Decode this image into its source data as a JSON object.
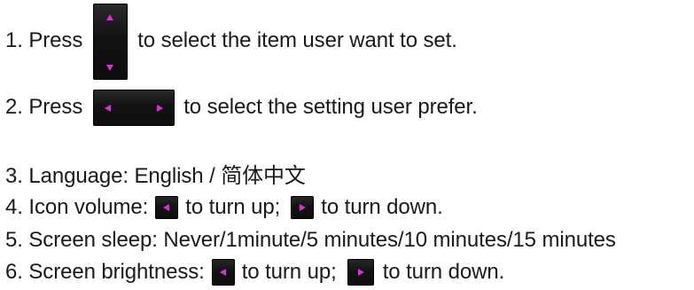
{
  "instructions": {
    "line1": {
      "prefix": "1. Press",
      "suffix": "to select the item user want to set.",
      "button_icon": "up-down-arrow-button"
    },
    "line2": {
      "prefix": "2. Press",
      "suffix": "to select the setting user prefer.",
      "button_icon": "left-right-arrow-button"
    },
    "line3": {
      "text": "3. Language: English / 简体中文"
    },
    "line4": {
      "prefix": "4. Icon volume:",
      "middle": "to turn up;",
      "suffix": "to turn down.",
      "icons": [
        "left-arrow-button",
        "right-arrow-button"
      ]
    },
    "line5": {
      "text": "5. Screen sleep: Never/1minute/5 minutes/10 minutes/15 minutes"
    },
    "line6": {
      "prefix": "6. Screen brightness:",
      "middle": "to turn up;",
      "suffix": "to turn down.",
      "icons": [
        "left-arrow-button",
        "right-arrow-button"
      ]
    }
  },
  "colors": {
    "arrow": "#e02bd6",
    "button_bg": "#141414",
    "text": "#1a1a1a"
  }
}
